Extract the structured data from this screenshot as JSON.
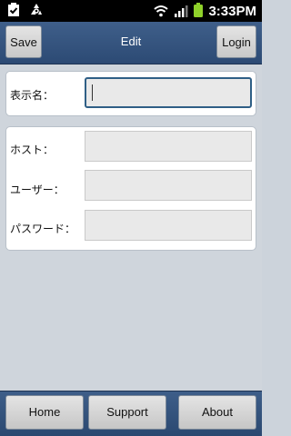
{
  "status_bar": {
    "time": "3:33PM",
    "icons": [
      "clipboard-check-icon",
      "recycle-icon",
      "wifi-icon",
      "signal-icon",
      "battery-icon"
    ]
  },
  "header": {
    "title": "Edit",
    "save_label": "Save",
    "login_label": "Login"
  },
  "form": {
    "display_name_label": "表示名：",
    "display_name_value": "",
    "host_label": "ホスト：",
    "host_value": "",
    "user_label": "ユーザー：",
    "user_value": "",
    "password_label": "パスワード：",
    "password_value": ""
  },
  "bottom_bar": {
    "tabs": [
      {
        "label": "Home"
      },
      {
        "label": "Support"
      },
      {
        "label": "About"
      }
    ]
  },
  "colors": {
    "header": "#34547f",
    "background": "#cfd5dc",
    "focus_border": "#2f5f86"
  }
}
